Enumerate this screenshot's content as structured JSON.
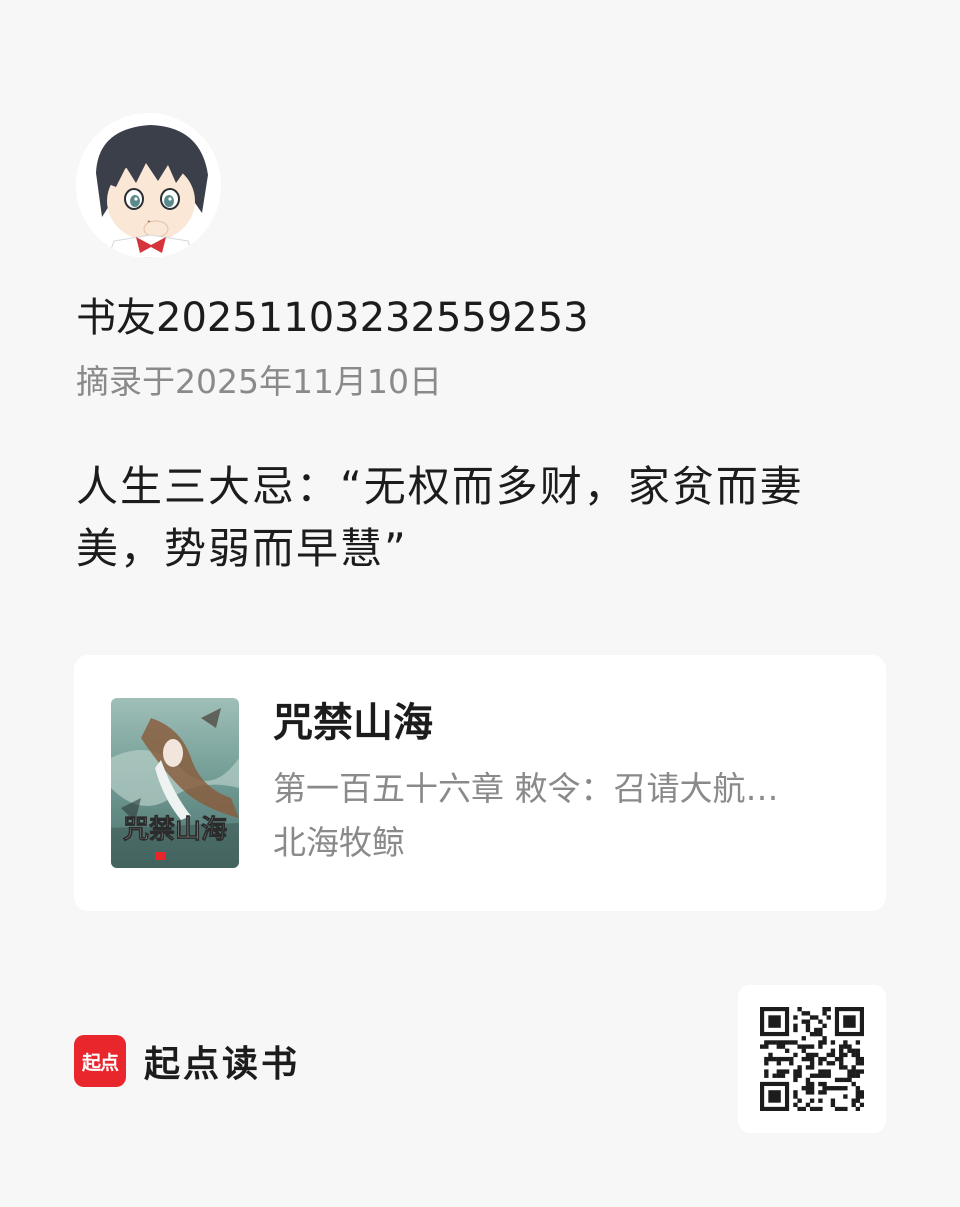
{
  "user": {
    "name": "书友20251103232559253",
    "excerpt_date": "摘录于2025年11月10日"
  },
  "quote": {
    "text": "人生三大忌：“无权而多财，家贫而妻美，势弱而早慧”"
  },
  "book": {
    "title": "咒禁山海",
    "chapter": "第一百五十六章 敕令：召请大航…",
    "author": "北海牧鲸",
    "cover_title": "咒禁山海"
  },
  "brand": {
    "logo_text": "起点",
    "name": "起点读书",
    "color": "#e8262c"
  },
  "icons": {
    "avatar": "anime-boy-avatar",
    "cover": "book-cover-image",
    "qr": "qr-code"
  }
}
